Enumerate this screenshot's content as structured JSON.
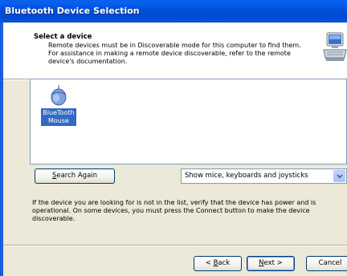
{
  "window": {
    "title": "Bluetooth Device Selection"
  },
  "header": {
    "title": "Select a device",
    "description_lines": [
      "Remote devices must be in Discoverable mode for this computer to find them.",
      "For assistance in making a remote device discoverable, refer to the remote",
      "device's documentation."
    ],
    "icon": "bluetooth-computer-icon"
  },
  "device_list": {
    "items": [
      {
        "label_lines": [
          "BlueTooth",
          "Mouse"
        ],
        "icon": "mouse-icon",
        "selected": true
      }
    ]
  },
  "search_again": {
    "label": "Search Again",
    "mnemonic": "S",
    "rest": "earch Again"
  },
  "filter": {
    "selected": "Show mice, keyboards and joysticks"
  },
  "info": {
    "lines": [
      "If the device you are looking for is not in the list, verify that the device has power and is",
      "operational. On some devices, you must press the Connect button to make the device",
      "discoverable."
    ]
  },
  "buttons": {
    "back": {
      "label": "< Back",
      "prefix": "< ",
      "mnemonic": "B",
      "rest": "ack"
    },
    "next": {
      "label": "Next >",
      "mnemonic": "N",
      "rest": "ext >"
    },
    "cancel": {
      "label": "Cancel"
    }
  },
  "colors": {
    "titlebar": "#0050d8",
    "dialog_bg": "#ece9d8",
    "selection": "#316ac5"
  }
}
